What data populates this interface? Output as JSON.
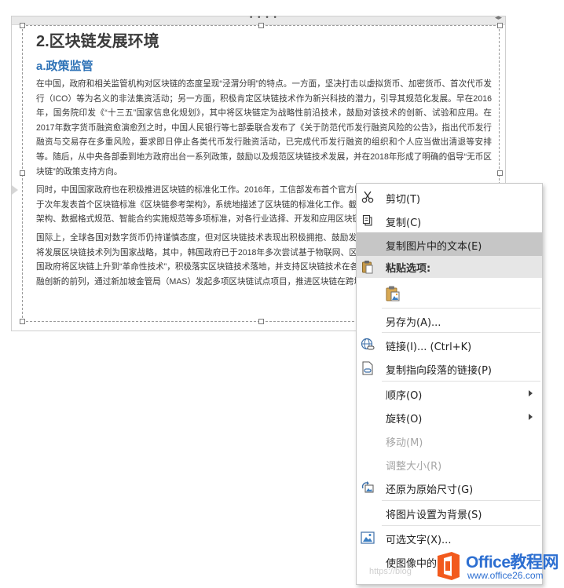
{
  "document": {
    "heading": "2.区块链发展环境",
    "subheading": "a.政策监管",
    "paragraphs": [
      "在中国，政府和相关监管机构对区块链的态度呈现“泾渭分明”的特点。一方面，坚决打击以虚拟货币、加密货币、首次代币发行（ICO）等为名义的非法集资活动；另一方面，积极肯定区块链技术作为新兴科技的潜力，引导其规范化发展。早在2016年，国务院印发《“十三五”国家信息化规划》，其中将区块链定为战略性前沿技术，鼓励对该技术的创新、试验和应用。在2017年数字货币融资愈演愈烈之时，中国人民银行等七部委联合发布了《关于防范代币发行融资风险的公告》，指出代币发行融资与交易存在多重风险，要求即日停止各类代币发行融资活动，已完成代币发行融资的组织和个人应当做出清退等安排等。随后，从中央各部委到地方政府出台一系列政策，鼓励以及规范区块链技术发展，并在2018年形成了明确的倡导“无币区块链”的政策支持方向。",
      "同时，中国国家政府也在积极推进区块链的标准化工作。2016年，工信部发布首个官方区块链指导文件《区块链白皮书》，并于次年发表首个区块链标准《区块链参考架构》，系统地描述了区块链的标准化工作。截至2019年，工信部已发布区块链参考架构、数据格式规范、智能合约实施规范等多项标准，对各行业选择、开发和应用区块链具有重要的指导和参考价值。",
      "国际上，全球各国对数字货币仍持谨慎态度，但对区块链技术表现出积极拥抱、鼓励发展的态度。目前，已有多个国家政府将发展区块链技术列为国家战略，其中，韩国政府已于2018年多次尝试基于物联网、区块链等技术的智慧城市建设落地；美国政府将区块链上升到“革命性技术”，积极落实区块链技术落地，并支持区块链技术在各领域的应用；新加坡则走在区块链金融创新的前列，通过新加坡金管局（MAS）发起多项区块链试点项目，推进区块链在跨境支付、贸易融资等方面的应用。"
    ]
  },
  "context_menu": {
    "items": [
      {
        "id": "cut",
        "label": "剪切(T)",
        "icon": "scissors-icon"
      },
      {
        "id": "copy",
        "label": "复制(C)",
        "icon": "copy-icon"
      },
      {
        "id": "copy-text-from-picture",
        "label": "复制图片中的文本(E)",
        "icon": "",
        "hover": true
      },
      {
        "id": "paste-options",
        "label": "粘贴选项:",
        "icon": "clipboard-icon"
      },
      {
        "id": "paste-picture",
        "label": "",
        "icon": "paste-picture-icon"
      },
      {
        "id": "save-as",
        "label": "另存为(A)...",
        "icon": ""
      },
      {
        "id": "link",
        "label": "链接(I)...  (Ctrl+K)",
        "icon": "globe-link-icon"
      },
      {
        "id": "copy-link-to-paragraph",
        "label": "复制指向段落的链接(P)",
        "icon": "document-link-icon"
      },
      {
        "id": "order",
        "label": "顺序(O)",
        "icon": "",
        "submenu": true
      },
      {
        "id": "rotate",
        "label": "旋转(O)",
        "icon": "",
        "submenu": true
      },
      {
        "id": "move",
        "label": "移动(M)",
        "icon": "",
        "disabled": true
      },
      {
        "id": "resize",
        "label": "调整大小(R)",
        "icon": "",
        "disabled": true
      },
      {
        "id": "reset-size",
        "label": "还原为原始尺寸(G)",
        "icon": "reset-size-icon"
      },
      {
        "id": "set-as-background",
        "label": "将图片设置为背景(S)",
        "icon": ""
      },
      {
        "id": "alt-text",
        "label": "可选文字(X)...",
        "icon": "alt-text-icon"
      },
      {
        "id": "make-image",
        "label": "使图像中的…",
        "icon": ""
      }
    ]
  },
  "watermark": {
    "brand": "Office教程网",
    "url": "www.office26.com",
    "blog": "https://blog"
  },
  "colors": {
    "heading": "#3b3b3b",
    "subheading": "#2f73b7",
    "menu_hover": "#c6c6c6",
    "paste_header": "#e6e6e6",
    "brand_orange": "#f25a1d",
    "brand_blue": "#2d6fd1"
  }
}
